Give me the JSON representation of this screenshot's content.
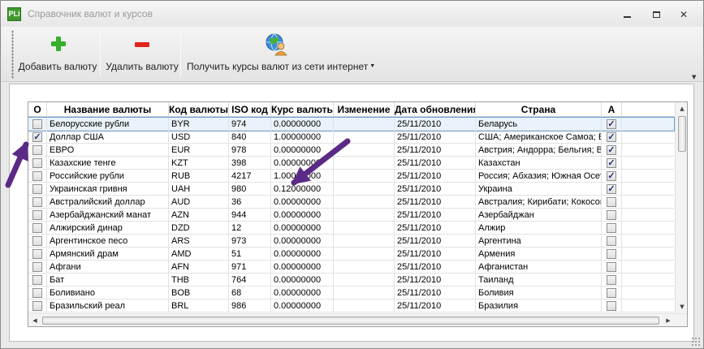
{
  "window": {
    "title": "Справочник валют и курсов",
    "app_icon_text": "PLi"
  },
  "toolbar": {
    "add_label": "Добавить валюту",
    "delete_label": "Удалить валюту",
    "get_rates_label": "Получить курсы валют из сети интернет",
    "add_icon": "plus-icon",
    "delete_icon": "minus-icon",
    "get_rates_icon": "globe-user-icon"
  },
  "grid": {
    "columns": [
      "О",
      "Название валюты",
      "Код валюты",
      "ISO код",
      "Курс валюты",
      "Изменение",
      "Дата обновления",
      "Страна",
      "А"
    ],
    "rows": [
      {
        "o": false,
        "name": "Белорусские рубли",
        "code": "BYR",
        "iso": "974",
        "rate": "0.00000000",
        "change": "",
        "date": "25/11/2010",
        "country": "Беларусь",
        "a": true,
        "selected": true
      },
      {
        "o": true,
        "name": "Доллар США",
        "code": "USD",
        "iso": "840",
        "rate": "1.00000000",
        "change": "",
        "date": "25/11/2010",
        "country": "США; Американское Самоа; Британская",
        "a": true,
        "selected": false
      },
      {
        "o": false,
        "name": "ЕВРО",
        "code": "EUR",
        "iso": "978",
        "rate": "0.00000000",
        "change": "",
        "date": "25/11/2010",
        "country": "Австрия; Андорра; Бельгия; Ватикан",
        "a": true,
        "selected": false
      },
      {
        "o": false,
        "name": "Казахские тенге",
        "code": "KZT",
        "iso": "398",
        "rate": "0.00000000",
        "change": "",
        "date": "25/11/2010",
        "country": "Казахстан",
        "a": true,
        "selected": false
      },
      {
        "o": false,
        "name": "Российские рубли",
        "code": "RUB",
        "iso": "4217",
        "rate": "1.00000000",
        "change": "",
        "date": "25/11/2010",
        "country": "Россия; Абхазия; Южная Осетия",
        "a": true,
        "selected": false
      },
      {
        "o": false,
        "name": "Украинская гривня",
        "code": "UAH",
        "iso": "980",
        "rate": "0.12000000",
        "change": "",
        "date": "25/11/2010",
        "country": "Украина",
        "a": true,
        "selected": false
      },
      {
        "o": false,
        "name": "Австралийский доллар",
        "code": "AUD",
        "iso": "36",
        "rate": "0.00000000",
        "change": "",
        "date": "25/11/2010",
        "country": "Австралия; Кирибати; Кокосовые",
        "a": false,
        "selected": false
      },
      {
        "o": false,
        "name": "Азербайджанский манат",
        "code": "AZN",
        "iso": "944",
        "rate": "0.00000000",
        "change": "",
        "date": "25/11/2010",
        "country": "Азербайджан",
        "a": false,
        "selected": false
      },
      {
        "o": false,
        "name": "Алжирский динар",
        "code": "DZD",
        "iso": "12",
        "rate": "0.00000000",
        "change": "",
        "date": "25/11/2010",
        "country": "Алжир",
        "a": false,
        "selected": false
      },
      {
        "o": false,
        "name": "Аргентинское песо",
        "code": "ARS",
        "iso": "973",
        "rate": "0.00000000",
        "change": "",
        "date": "25/11/2010",
        "country": "Аргентина",
        "a": false,
        "selected": false
      },
      {
        "o": false,
        "name": "Армянский драм",
        "code": "AMD",
        "iso": "51",
        "rate": "0.00000000",
        "change": "",
        "date": "25/11/2010",
        "country": "Армения",
        "a": false,
        "selected": false
      },
      {
        "o": false,
        "name": "Афгани",
        "code": "AFN",
        "iso": "971",
        "rate": "0.00000000",
        "change": "",
        "date": "25/11/2010",
        "country": "Афганистан",
        "a": false,
        "selected": false
      },
      {
        "o": false,
        "name": "Бат",
        "code": "THB",
        "iso": "764",
        "rate": "0.00000000",
        "change": "",
        "date": "25/11/2010",
        "country": "Таиланд",
        "a": false,
        "selected": false
      },
      {
        "o": false,
        "name": "Боливиано",
        "code": "BOB",
        "iso": "68",
        "rate": "0.00000000",
        "change": "",
        "date": "25/11/2010",
        "country": "Боливия",
        "a": false,
        "selected": false
      },
      {
        "o": false,
        "name": "Бразильский реал",
        "code": "BRL",
        "iso": "986",
        "rate": "0.00000000",
        "change": "",
        "date": "25/11/2010",
        "country": "Бразилия",
        "a": false,
        "selected": false
      }
    ]
  },
  "colors": {
    "annotation_arrow": "#5b2a86",
    "selection_border": "#6a9fd4",
    "add_green": "#36b02a",
    "delete_red": "#e3231d"
  }
}
